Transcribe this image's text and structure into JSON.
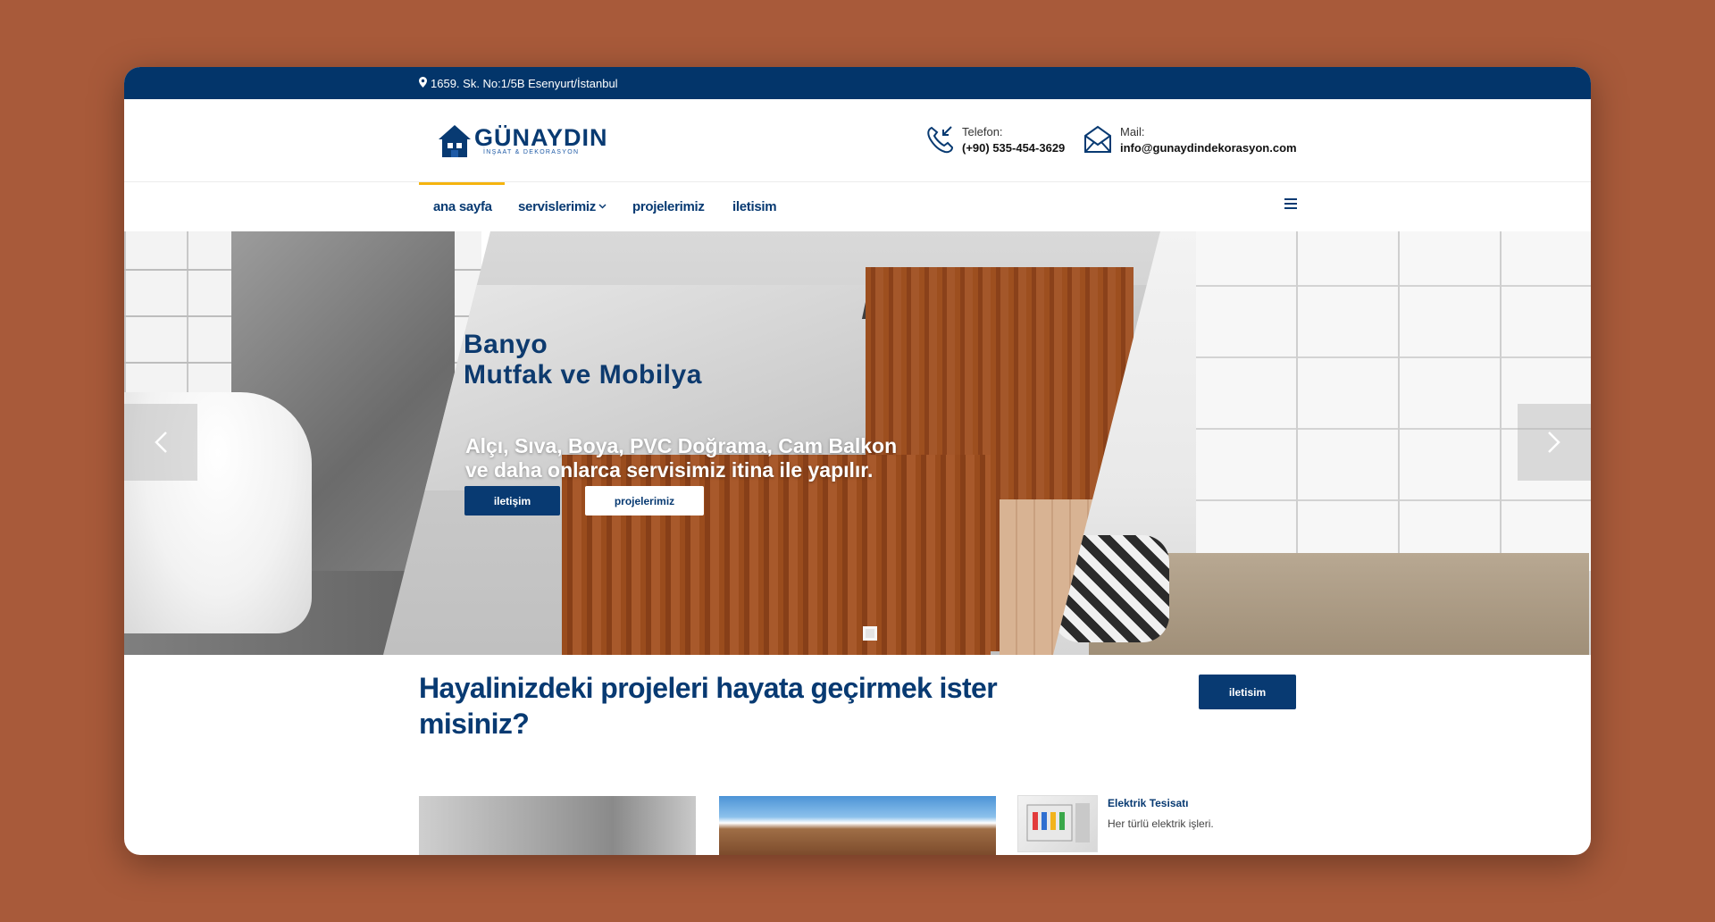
{
  "topbar": {
    "address": "1659. Sk. No:1/5B Esenyurt/İstanbul"
  },
  "brand": {
    "name": "GÜNAYDIN",
    "tagline": "İNŞAAT & DEKORASYON"
  },
  "contact": {
    "phone_label": "Telefon:",
    "phone_value": "(+90) 535-454-3629",
    "mail_label": "Mail:",
    "mail_value": "info@gunaydindekorasyon.com"
  },
  "nav": {
    "items": [
      {
        "label": "ana sayfa",
        "active": true
      },
      {
        "label": "servislerimiz",
        "dropdown": true
      },
      {
        "label": "projelerimiz"
      },
      {
        "label": "iletisim"
      }
    ],
    "menu_icon": "hamburger-icon"
  },
  "hero": {
    "heading_line1": "Banyo",
    "heading_line2": "Mutfak ve Mobilya",
    "sub_line1": "Alçı, Sıva, Boya, PVC Doğrama, Cam Balkon",
    "sub_line2": "ve daha onlarca servisimiz itina ile yapılır.",
    "btn_primary": "iletişim",
    "btn_secondary": "projelerimiz",
    "prev_icon": "chevron-left-icon",
    "next_icon": "chevron-right-icon",
    "slide_count": 1
  },
  "cta": {
    "title": "Hayalinizdeki projeleri hayata geçirmek ister misiniz?",
    "button": "iletisim"
  },
  "services": [
    {
      "title": "Elektrik Tesisatı",
      "desc": "Her türlü elektrik işleri."
    }
  ],
  "colors": {
    "primary": "#083a72",
    "topbar": "#03356a",
    "accent": "#f5b40f",
    "background": "#a85a3a"
  }
}
